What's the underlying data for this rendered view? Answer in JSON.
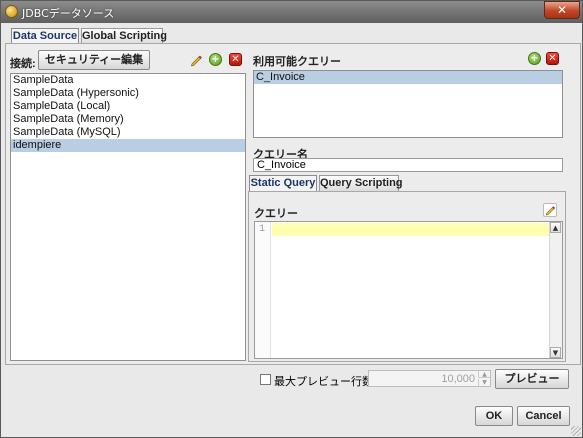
{
  "window": {
    "title": "JDBCデータソース",
    "close_icon": "close-icon"
  },
  "tabs": [
    {
      "label": "Data Source",
      "active": true
    },
    {
      "label": "Global Scripting",
      "active": false
    }
  ],
  "connection": {
    "label": "接続:",
    "security_button": "セキュリティー編集",
    "items": [
      "SampleData",
      "SampleData (Hypersonic)",
      "SampleData (Local)",
      "SampleData (Memory)",
      "SampleData (MySQL)",
      "idempiere"
    ],
    "selected": "idempiere",
    "icons": [
      "edit-icon",
      "add-icon",
      "delete-icon"
    ]
  },
  "queries": {
    "label": "利用可能クエリー",
    "items": [
      "C_Invoice"
    ],
    "selected": "C_Invoice",
    "icons": [
      "add-icon",
      "delete-icon"
    ]
  },
  "query_name": {
    "label": "クエリー名",
    "value": "C_Invoice"
  },
  "query_tabs": [
    {
      "label": "Static Query",
      "active": true
    },
    {
      "label": "Query Scripting",
      "active": false
    }
  ],
  "query_editor": {
    "label": "クエリー",
    "line_number": "1",
    "content": ""
  },
  "footer": {
    "max_preview_label": "最大プレビュー行数",
    "max_preview_checked": false,
    "max_preview_value": "10,000",
    "preview_button": "プレビュー",
    "ok_button": "OK",
    "cancel_button": "Cancel"
  },
  "colors": {
    "selection": "#b9cde3",
    "current_line": "#fffdb2",
    "close_button": "#c24526",
    "tab_active_text": "#1c3766"
  }
}
